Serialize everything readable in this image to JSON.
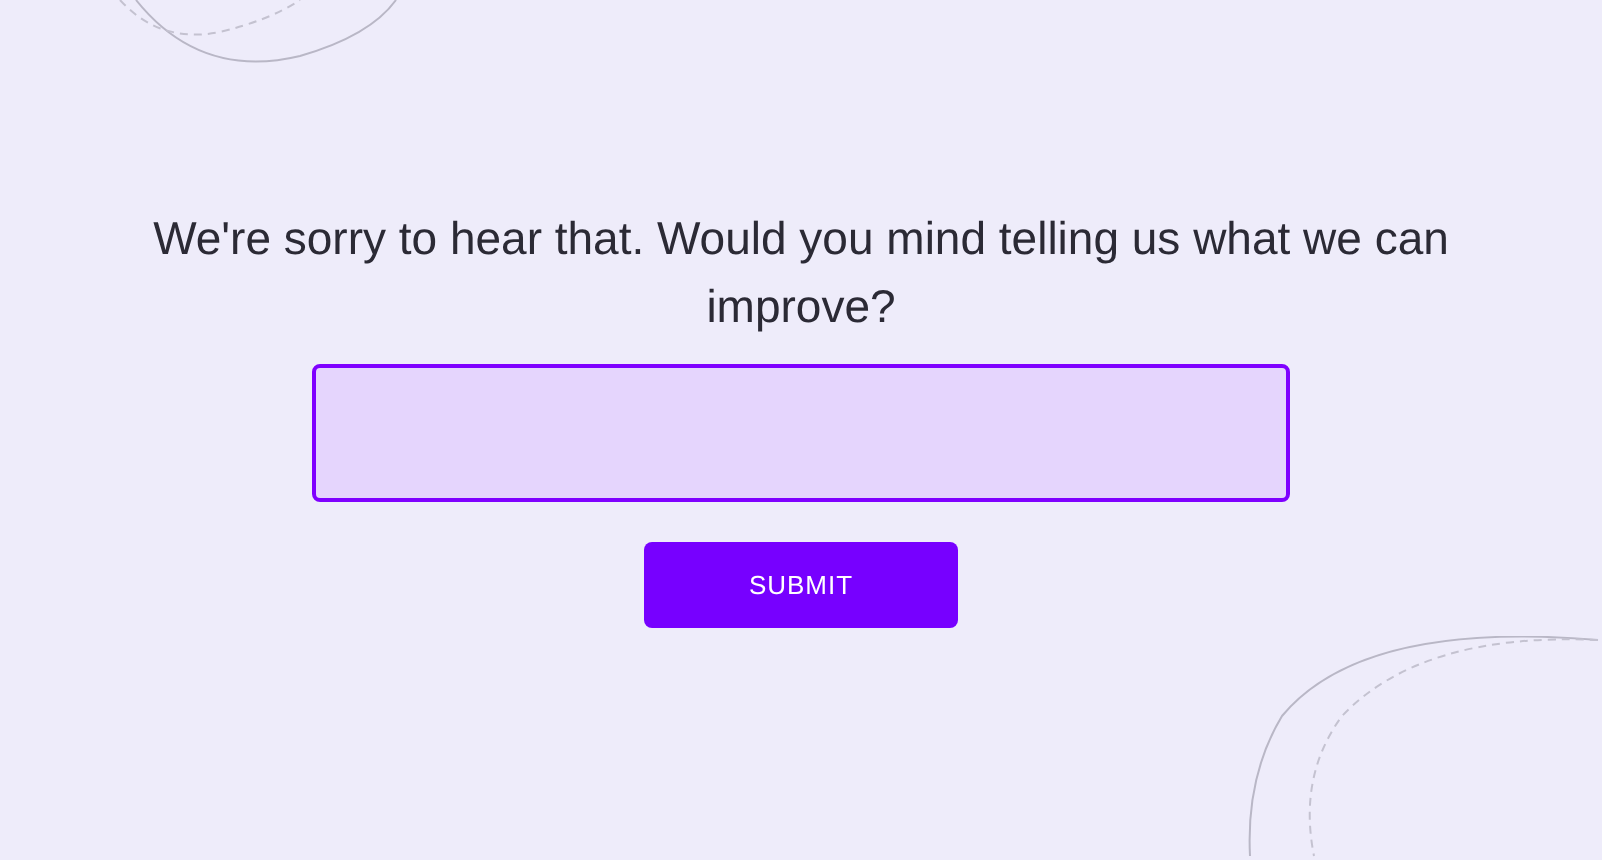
{
  "prompt": "We're sorry to hear that. Would you mind telling us what we can improve?",
  "submit_button": {
    "label": "SUBMIT"
  }
}
